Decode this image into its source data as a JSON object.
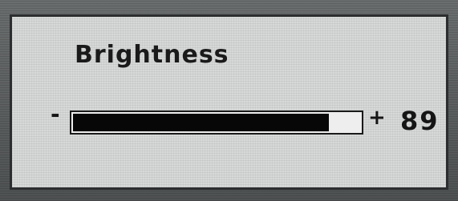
{
  "osd": {
    "title": "Brightness",
    "decrease_symbol": "-",
    "increase_symbol": "+",
    "value": "89",
    "level_percent": 89
  },
  "colors": {
    "panel_background": "#d7d9d8",
    "bar_fill": "#070707",
    "bar_track": "#eeeeee",
    "text": "#1a1a1a",
    "bezel": "#5a5d5e"
  },
  "icons": {
    "decrease": "minus-icon",
    "increase": "plus-icon"
  }
}
